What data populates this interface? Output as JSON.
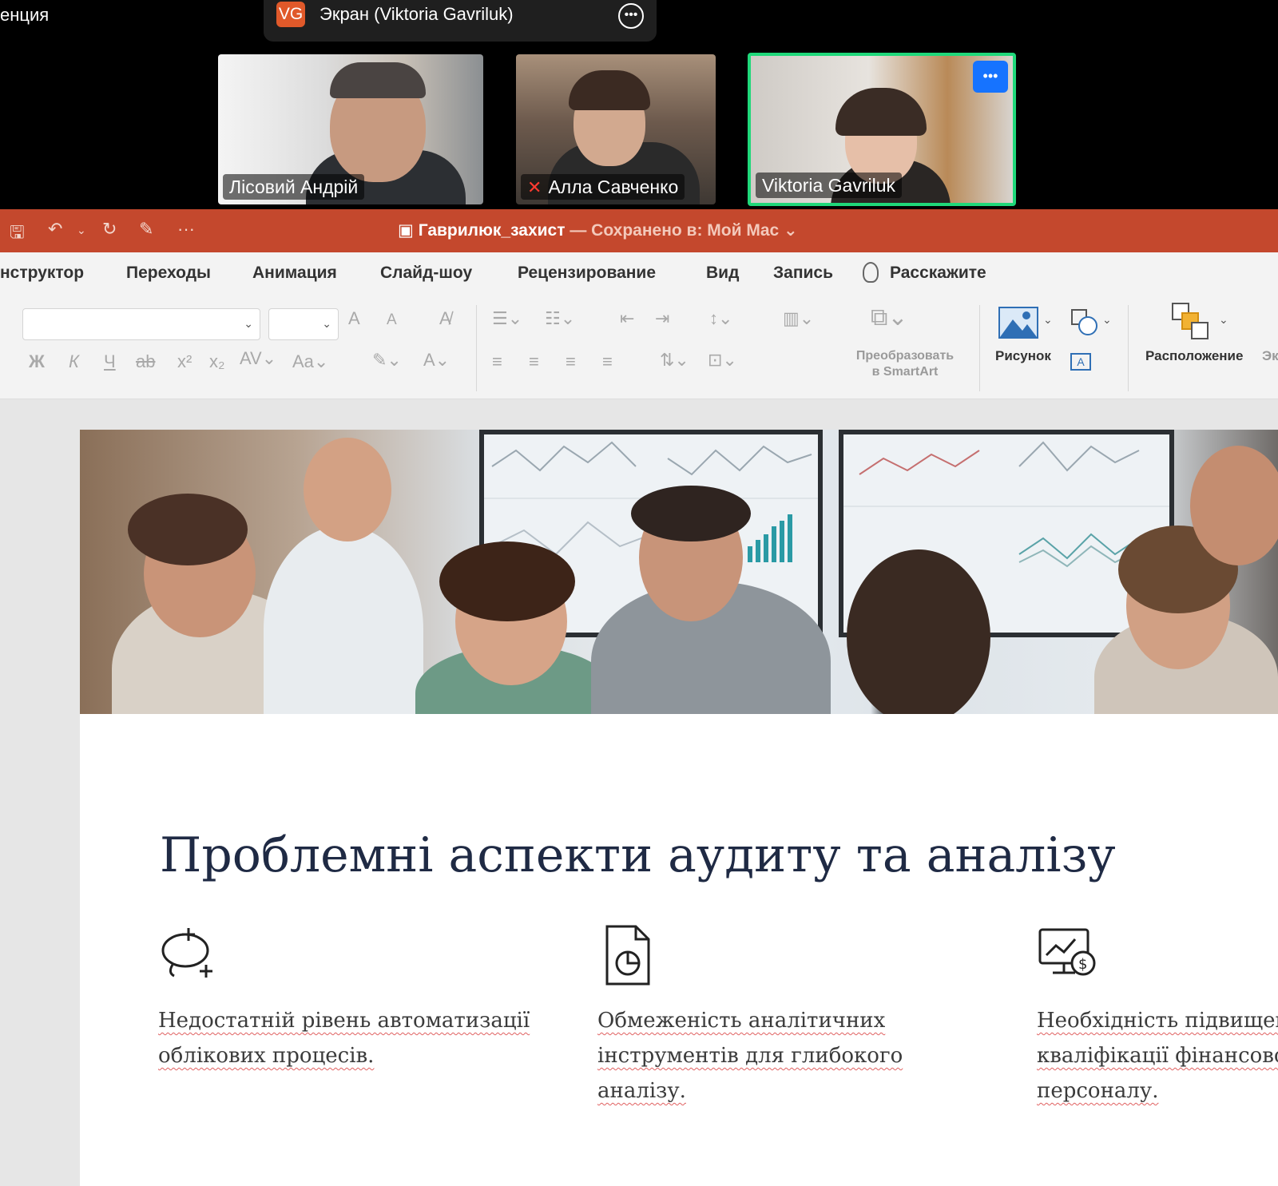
{
  "zoom": {
    "left_label": "енция",
    "share": {
      "initials": "VG",
      "text": "Экран (Viktoria Gavriluk)"
    },
    "participants": [
      {
        "name": "Лісовий Андрій",
        "muted": false
      },
      {
        "name": "Алла Савченко",
        "muted": true
      },
      {
        "name": "Viktoria Gavriluk",
        "muted": false,
        "active_speaker": true
      }
    ]
  },
  "powerpoint": {
    "doc_name": "Гаврилюк_захист",
    "saved_text": "— Сохранено в: Мой Mac",
    "tabs": [
      "нструктор",
      "Переходы",
      "Анимация",
      "Слайд-шоу",
      "Рецензирование",
      "Вид",
      "Запись"
    ],
    "tell_me": "Расскажите",
    "ribbon": {
      "smartart_line1": "Преобразовать",
      "smartart_line2": "в SmartArt",
      "picture_label": "Рисунок",
      "arrange_label": "Расположение",
      "cut_label": "Эк",
      "bold": "Ж",
      "italic": "К",
      "underline": "Ч",
      "font_grow": "A",
      "font_shrink": "A"
    }
  },
  "slide": {
    "title": "Проблемні аспекти аудиту та аналізу",
    "features": [
      {
        "icon": "idea-plus-icon",
        "text": "Недостатній рівень автоматизації облікових процесів."
      },
      {
        "icon": "document-chart-icon",
        "text": "Обмеженість аналітичних інструментів для глибокого аналізу."
      },
      {
        "icon": "finance-monitor-icon",
        "text": "Необхідність підвищення кваліфікації фінансового персоналу."
      }
    ]
  },
  "colors": {
    "ppt_accent": "#c4482d",
    "active_speaker_border": "#1fd87a",
    "title_color": "#1f2a44"
  }
}
